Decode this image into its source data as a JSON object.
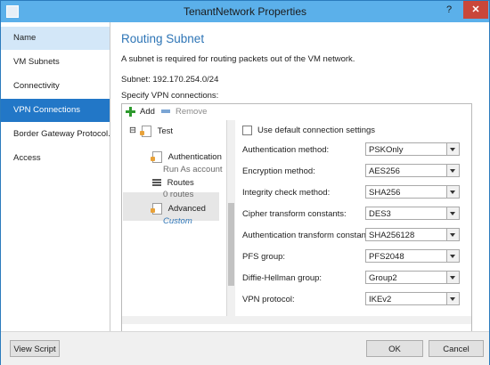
{
  "window": {
    "title": "TenantNetwork Properties",
    "help_glyph": "?",
    "close_glyph": "✕"
  },
  "sidebar": {
    "items": [
      {
        "label": "Name"
      },
      {
        "label": "VM Subnets"
      },
      {
        "label": "Connectivity"
      },
      {
        "label": "VPN Connections"
      },
      {
        "label": "Border Gateway Protocol..."
      },
      {
        "label": "Access"
      }
    ]
  },
  "main": {
    "heading": "Routing Subnet",
    "description": "A subnet is required for routing packets out of the VM network.",
    "subnet": "Subnet: 192.170.254.0/24",
    "vpn_label": "Specify VPN connections:",
    "toolbar": {
      "add_label": "Add",
      "remove_label": "Remove"
    },
    "tree": {
      "toggle": "⊟",
      "root": "Test",
      "nodes": [
        {
          "title": "Authentication",
          "subtitle": "Run As account"
        },
        {
          "title": "Routes",
          "subtitle": "0 routes"
        },
        {
          "title": "Advanced",
          "subtitle": "Custom"
        }
      ]
    },
    "settings": {
      "default_checkbox_label": "Use default connection settings",
      "fields": [
        {
          "label": "Authentication method:",
          "value": "PSKOnly"
        },
        {
          "label": "Encryption method:",
          "value": "AES256"
        },
        {
          "label": "Integrity check method:",
          "value": "SHA256"
        },
        {
          "label": "Cipher transform constants:",
          "value": "DES3"
        },
        {
          "label": "Authentication transform constants:",
          "value": "SHA256128"
        },
        {
          "label": "PFS group:",
          "value": "PFS2048"
        },
        {
          "label": "Diffie-Hellman group:",
          "value": "Group2"
        },
        {
          "label": "VPN protocol:",
          "value": "IKEv2"
        }
      ]
    }
  },
  "footer": {
    "view_script": "View Script",
    "ok": "OK",
    "cancel": "Cancel"
  },
  "colors": {
    "titlebar": "#5bb0ea",
    "active_nav": "#2277c7",
    "heading": "#2e75b6",
    "close": "#c9473a"
  }
}
